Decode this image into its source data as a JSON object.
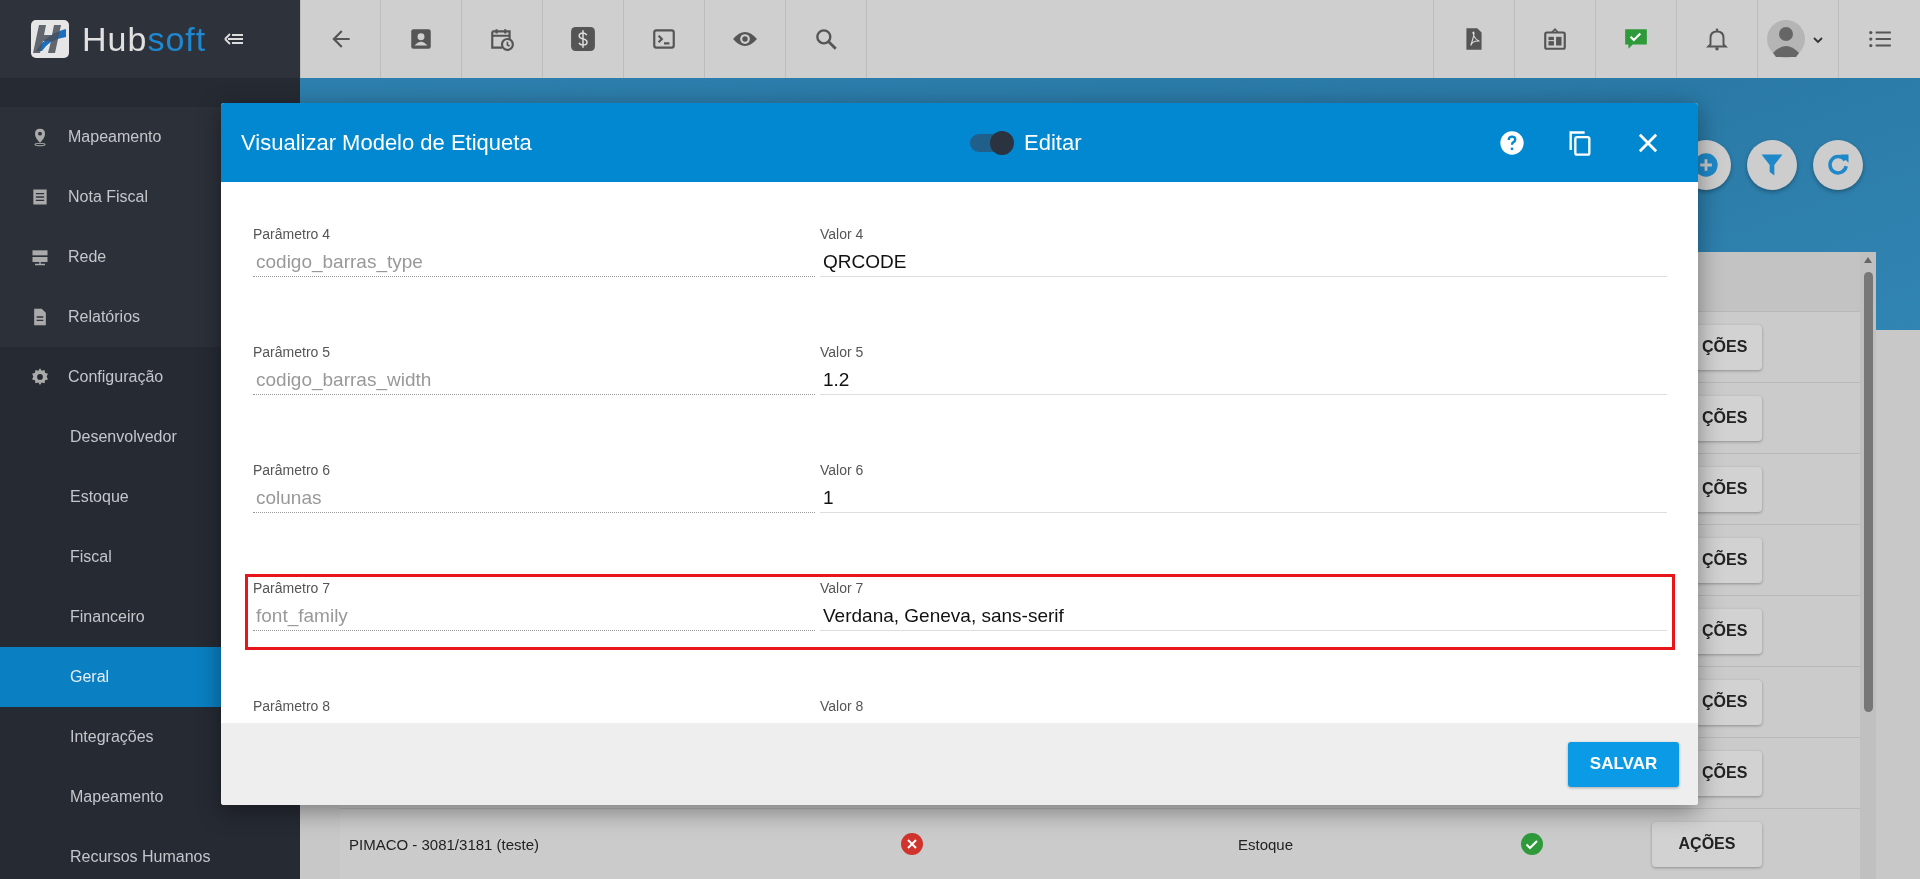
{
  "brand": {
    "first": "Hub",
    "second": "soft"
  },
  "topbar": {
    "left_tools": [
      {
        "kind": "back"
      },
      {
        "kind": "contact"
      },
      {
        "kind": "calendar"
      },
      {
        "kind": "dollar"
      },
      {
        "kind": "terminal"
      },
      {
        "kind": "eye"
      },
      {
        "kind": "search"
      }
    ],
    "right_tools": [
      {
        "kind": "pdf"
      },
      {
        "kind": "board"
      },
      {
        "kind": "chat"
      },
      {
        "kind": "bell"
      },
      {
        "kind": "avatar"
      },
      {
        "kind": "list"
      }
    ]
  },
  "sidebar": {
    "items": [
      {
        "label": "Mapeamento",
        "kind": "section",
        "selected": false
      },
      {
        "label": "Nota Fiscal",
        "kind": "section",
        "selected": false
      },
      {
        "label": "Rede",
        "kind": "section",
        "selected": false
      },
      {
        "label": "Relatórios",
        "kind": "section",
        "selected": false
      },
      {
        "label": "Configuração",
        "kind": "section",
        "selected": false
      },
      {
        "label": "Desenvolvedor",
        "kind": "subitem",
        "selected": false
      },
      {
        "label": "Estoque",
        "kind": "subitem",
        "selected": false
      },
      {
        "label": "Fiscal",
        "kind": "subitem",
        "selected": false
      },
      {
        "label": "Financeiro",
        "kind": "subitem",
        "selected": false
      },
      {
        "label": "Geral",
        "kind": "subitem",
        "selected": true
      },
      {
        "label": "Integrações",
        "kind": "subitem",
        "selected": false
      },
      {
        "label": "Mapeamento",
        "kind": "subitem",
        "selected": false
      },
      {
        "label": "Recursos Humanos",
        "kind": "subitem",
        "selected": false
      }
    ]
  },
  "table": {
    "rows": [
      {
        "action": "ÇÕES"
      },
      {
        "action": "ÇÕES"
      },
      {
        "action": "ÇÕES"
      },
      {
        "action": "ÇÕES"
      },
      {
        "action": "ÇÕES"
      },
      {
        "action": "ÇÕES"
      },
      {
        "action": "ÇÕES"
      },
      {
        "name": "PIMACO - 3081/3181 (teste)",
        "valid": false,
        "category": "Estoque",
        "active": true,
        "action": "AÇÕES"
      }
    ]
  },
  "dialog": {
    "title": "Visualizar Modelo de Etiqueta",
    "edit_toggle": {
      "label": "Editar",
      "on": true
    },
    "params": [
      {
        "param_label": "Parâmetro 4",
        "param": "codigo_barras_type",
        "value_label": "Valor 4",
        "value": "QRCODE",
        "highlighted": false
      },
      {
        "param_label": "Parâmetro 5",
        "param": "codigo_barras_width",
        "value_label": "Valor 5",
        "value": "1.2",
        "highlighted": false
      },
      {
        "param_label": "Parâmetro 6",
        "param": "colunas",
        "value_label": "Valor 6",
        "value": "1",
        "highlighted": false
      },
      {
        "param_label": "Parâmetro 7",
        "param": "font_family",
        "value_label": "Valor 7",
        "value": "Verdana, Geneva, sans-serif",
        "highlighted": true
      },
      {
        "param_label": "Parâmetro 8",
        "value_label": "Valor 8",
        "highlighted": false
      }
    ],
    "save_button": "SALVAR"
  }
}
